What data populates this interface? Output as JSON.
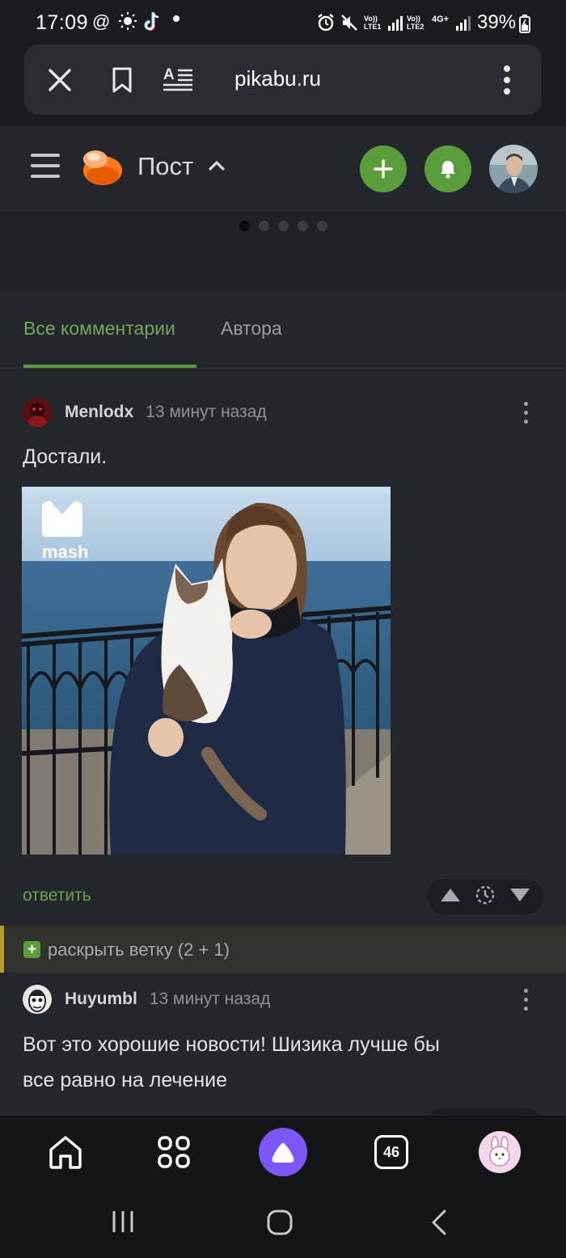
{
  "status_bar": {
    "time": "17:09",
    "left_icons": [
      "at-icon",
      "brightness-icon",
      "tiktok-icon",
      "dot-icon"
    ],
    "right_icons": [
      "alarm-icon",
      "mute-icon",
      "lte1-icon",
      "signal-icon",
      "lte2-icon",
      "4g-icon",
      "signal-icon"
    ],
    "lte1": "Vo)) LTE1",
    "lte2": "Vo)) LTE2",
    "net": "4G+",
    "battery": "39%"
  },
  "browser": {
    "url": "pikabu.ru",
    "icons": [
      "close-icon",
      "bookmark-icon",
      "reader-mode-icon",
      "more-vert-icon"
    ]
  },
  "header": {
    "title": "Пост",
    "icons": [
      "menu-icon",
      "pikabu-logo",
      "chevron-up-icon",
      "add-icon",
      "bell-icon",
      "user-avatar"
    ],
    "accent": "#5a9e3c"
  },
  "carousel": {
    "dots": 5,
    "active": 0
  },
  "tabs": [
    {
      "label": "Все комментарии",
      "active": true
    },
    {
      "label": "Автора",
      "active": false
    }
  ],
  "comments": [
    {
      "author": "Menlodx",
      "time": "13 минут назад",
      "text": "Достали.",
      "image": {
        "watermark": "mash",
        "description": "cat-photo"
      },
      "reply_label": "ответить",
      "vote_icons": [
        "arrow-up-icon",
        "history-icon",
        "arrow-down-icon"
      ]
    },
    {
      "author": "Huyumbl",
      "time": "13 минут назад",
      "text_line1": "Вот это хорошие новости! Шизика лучше бы",
      "text_line2": "все равно на лечение"
    }
  ],
  "expand_branch": {
    "label": "раскрыть ветку (2 + 1)",
    "border_color": "#b99a2a"
  },
  "bottom_nav": {
    "items": [
      "home-icon",
      "apps-icon",
      "assistant-icon",
      "tabs-icon",
      "profile-icon"
    ],
    "tabs_count": "46"
  },
  "system_nav": [
    "recents-icon",
    "home-button-icon",
    "back-icon"
  ]
}
